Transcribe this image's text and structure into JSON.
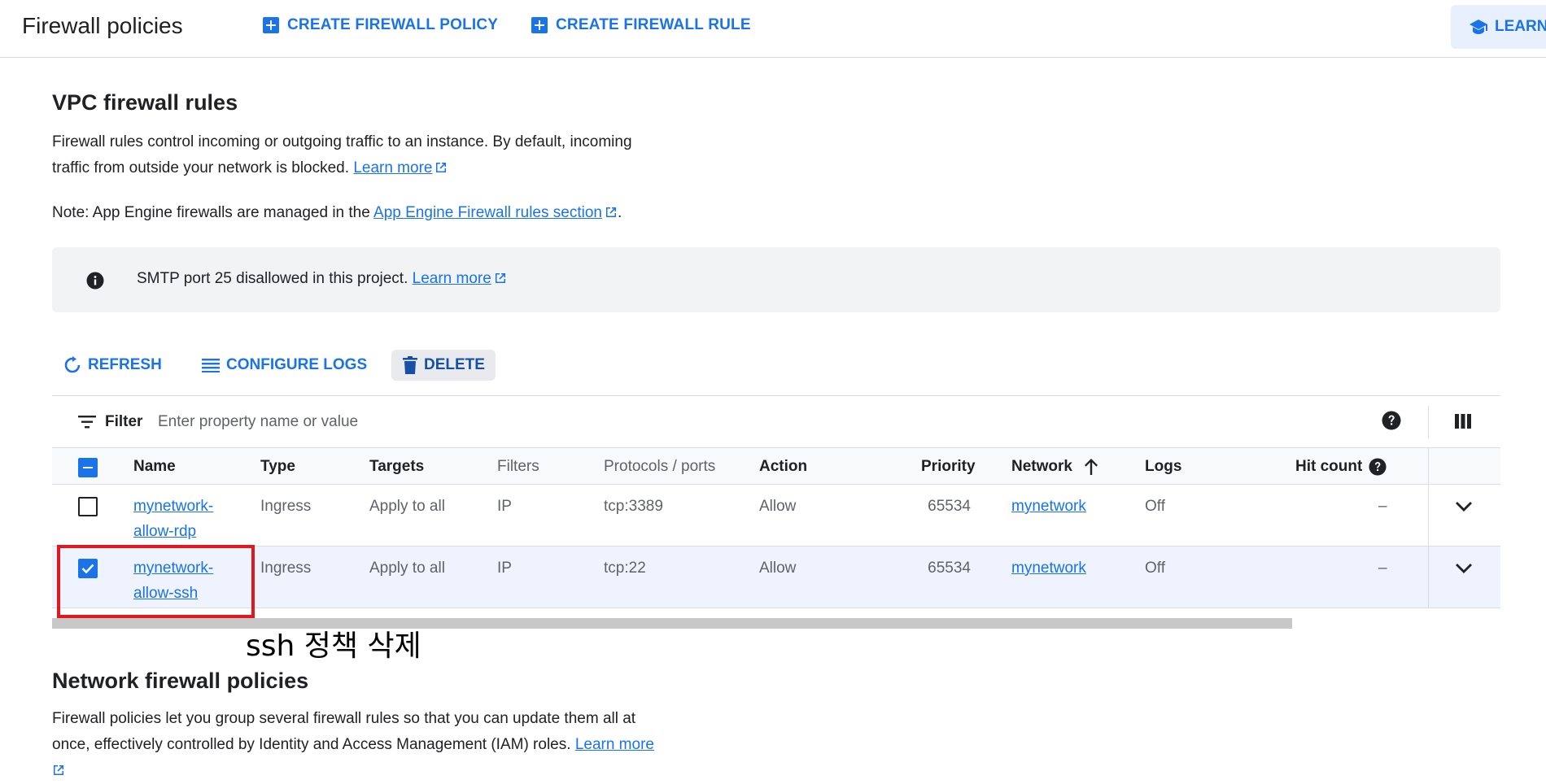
{
  "header": {
    "title": "Firewall policies",
    "create_policy_label": "CREATE FIREWALL POLICY",
    "create_rule_label": "CREATE FIREWALL RULE",
    "learn_label": "LEARN"
  },
  "vpc": {
    "title": "VPC firewall rules",
    "desc_line1": "Firewall rules control incoming or outgoing traffic to an instance. By default, incoming",
    "desc_line2": "traffic from outside your network is blocked.",
    "learn_more": "Learn more",
    "note_prefix": "Note: App Engine firewalls are managed in the",
    "note_link": "App Engine Firewall rules section",
    "note_suffix": "."
  },
  "banner": {
    "text": "SMTP port 25 disallowed in this project.",
    "learn_more": "Learn more"
  },
  "toolbar": {
    "refresh_label": "REFRESH",
    "configure_logs_label": "CONFIGURE LOGS",
    "delete_label": "DELETE"
  },
  "filter": {
    "label": "Filter",
    "placeholder": "Enter property name or value"
  },
  "table": {
    "columns": {
      "name": "Name",
      "type": "Type",
      "targets": "Targets",
      "filters": "Filters",
      "protocols": "Protocols / ports",
      "action": "Action",
      "priority": "Priority",
      "network": "Network",
      "logs": "Logs",
      "hit_count": "Hit count"
    },
    "rows": [
      {
        "name": "mynetwork-allow-rdp",
        "type": "Ingress",
        "targets": "Apply to all",
        "filters": "IP",
        "protocols": "tcp:3389",
        "action": "Allow",
        "priority": "65534",
        "network": "mynetwork",
        "logs": "Off",
        "hit_count": "–",
        "checked": false
      },
      {
        "name": "mynetwork-allow-ssh",
        "type": "Ingress",
        "targets": "Apply to all",
        "filters": "IP",
        "protocols": "tcp:22",
        "action": "Allow",
        "priority": "65534",
        "network": "mynetwork",
        "logs": "Off",
        "hit_count": "–",
        "checked": true
      }
    ]
  },
  "annotation": {
    "text": "ssh 정책 삭제",
    "highlight_color": "#e0191e"
  },
  "network_policies": {
    "title": "Network firewall policies",
    "desc_line1": "Firewall policies let you group several firewall rules so that you can update them all at",
    "desc_line2": "once, effectively controlled by Identity and Access Management (IAM) roles.",
    "learn_more": "Learn more"
  },
  "colors": {
    "accent": "#1a73e8",
    "text": "#202124",
    "muted": "#5f6368",
    "selected_row": "#eef3fd"
  }
}
